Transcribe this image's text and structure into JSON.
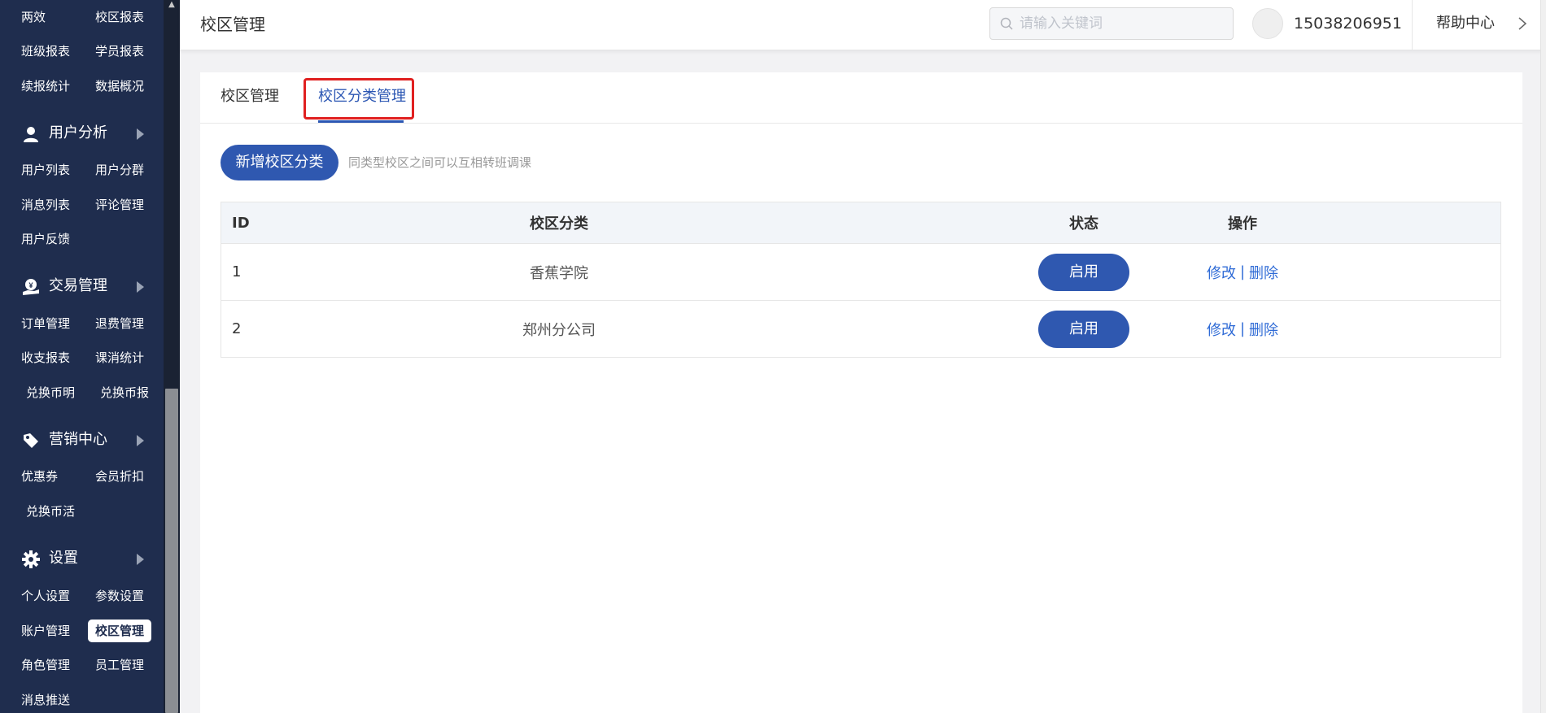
{
  "sidebar": {
    "rows": [
      [
        "两效",
        "校区报表"
      ],
      [
        "班级报表",
        "学员报表"
      ],
      [
        "续报统计",
        "数据概况"
      ]
    ],
    "sections": [
      {
        "label": "用户分析",
        "icon": "user-icon",
        "rows": [
          [
            "用户列表",
            "用户分群"
          ],
          [
            "消息列表",
            "评论管理"
          ],
          [
            "用户反馈"
          ]
        ]
      },
      {
        "label": "交易管理",
        "icon": "money-bag-icon",
        "rows": [
          [
            "订单管理",
            "退费管理"
          ],
          [
            "收支报表",
            "课消统计"
          ],
          [
            "兑换币明",
            "兑换币报"
          ]
        ]
      },
      {
        "label": "营销中心",
        "icon": "tag-icon",
        "rows": [
          [
            "优惠券",
            "会员折扣"
          ],
          [
            "兑换币活"
          ]
        ]
      },
      {
        "label": "设置",
        "icon": "gear-icon",
        "rows": [
          [
            "个人设置",
            "参数设置"
          ],
          [
            "账户管理",
            "校区管理"
          ],
          [
            "角色管理",
            "员工管理"
          ],
          [
            "消息推送"
          ]
        ]
      }
    ],
    "active_item": "校区管理"
  },
  "header": {
    "title": "校区管理",
    "search_placeholder": "请输入关键词",
    "phone": "15038206951",
    "help": "帮助中心"
  },
  "tabs": [
    {
      "label": "校区管理",
      "active": false
    },
    {
      "label": "校区分类管理",
      "active": true
    }
  ],
  "toolbar": {
    "add_label": "新增校区分类",
    "hint": "同类型校区之间可以互相转班调课"
  },
  "table": {
    "headers": {
      "id": "ID",
      "category": "校区分类",
      "status": "状态",
      "ops": "操作"
    },
    "rows": [
      {
        "id": "1",
        "category": "香蕉学院",
        "status": "启用",
        "edit": "修改",
        "sep": "|",
        "delete": "删除"
      },
      {
        "id": "2",
        "category": "郑州分公司",
        "status": "启用",
        "edit": "修改",
        "sep": "|",
        "delete": "删除"
      }
    ]
  },
  "colors": {
    "sidebar_bg": "#1f2d4e",
    "primary": "#2f58b0",
    "link": "#2f6bd6",
    "highlight": "#e02020"
  }
}
